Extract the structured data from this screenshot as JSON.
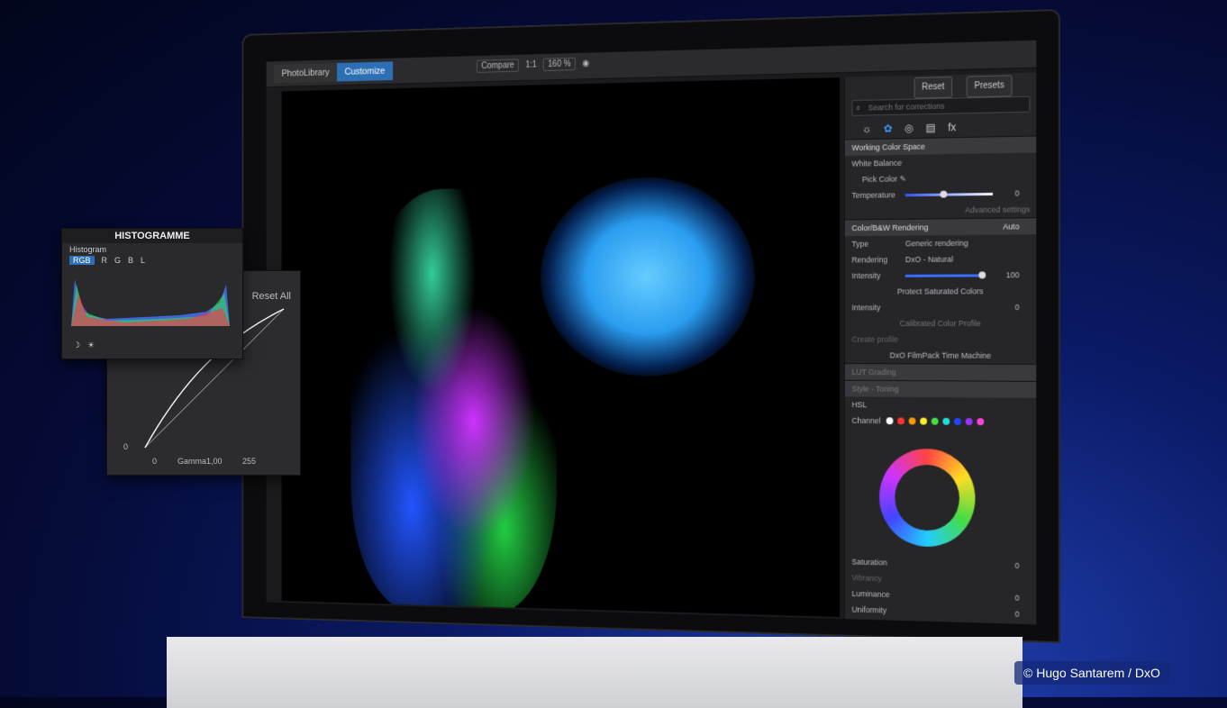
{
  "app": {
    "tabs": [
      "PhotoLibrary",
      "Customize"
    ],
    "toolbar": {
      "compare": "Compare",
      "ratio": "1:1",
      "zoom": "160 %"
    }
  },
  "panel": {
    "reset": "Reset",
    "presets": "Presets",
    "search_placeholder": "Search for corrections",
    "working_color_space": "Working Color Space",
    "white_balance": "White Balance",
    "pick_color": "Pick Color",
    "temperature": "Temperature",
    "temperature_value": "0",
    "advanced_settings": "Advanced settings",
    "auto": "Auto",
    "color_bw_rendering": "Color/B&W Rendering",
    "type_label": "Type",
    "type_value": "Generic rendering",
    "rendering_label": "Rendering",
    "rendering_value": "DxO - Natural",
    "intensity_label": "Intensity",
    "intensity_value": "100",
    "protect_saturated_colors": "Protect Saturated Colors",
    "protect_intensity_label": "Intensity",
    "protect_intensity_value": "0",
    "calibrated_color_profile": "Calibrated Color Profile",
    "create_profile": "Create profile",
    "filmpack": "DxO FilmPack Time Machine",
    "lut_grading": "LUT Grading",
    "style_toning": "Style - Toning",
    "hsl": "HSL",
    "channel": "Channel",
    "saturation": "Saturation",
    "saturation_value": "0",
    "vibrancy": "Vibrancy",
    "luminance": "Luminance",
    "luminance_value": "0",
    "uniformity": "Uniformity",
    "uniformity_value": "0"
  },
  "histogram": {
    "window_title": "HISTOGRAMME",
    "panel_title": "Histogram",
    "channels": [
      "RGB",
      "R",
      "G",
      "B",
      "L"
    ]
  },
  "curve": {
    "reset_all": "Reset All",
    "min_input": "0",
    "min_output": "0",
    "gamma_label": "Gamma",
    "gamma_value": "1,00",
    "max_output": "255"
  },
  "credit": "© Hugo Santarem / DxO",
  "channel_colors": [
    "#ffffff",
    "#ff3333",
    "#ff9900",
    "#ffee22",
    "#44dd44",
    "#22dddd",
    "#2244ff",
    "#9933ff",
    "#ff44dd"
  ]
}
